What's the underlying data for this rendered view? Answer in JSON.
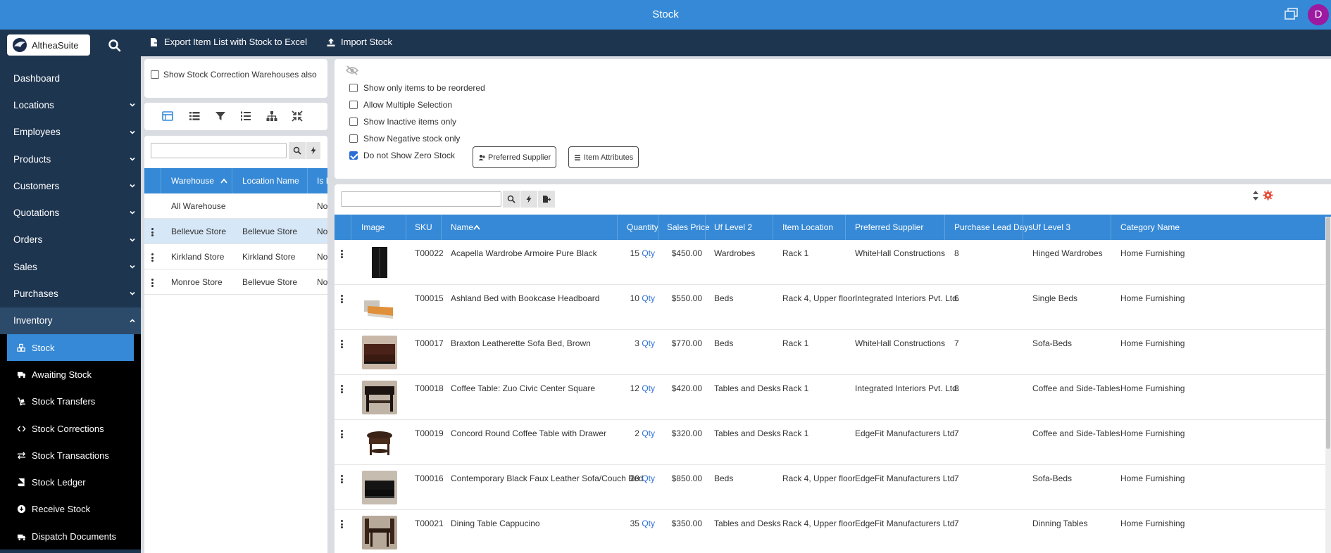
{
  "topbar": {
    "title": "Stock",
    "avatar_letter": "D"
  },
  "brand": {
    "name": "AltheaSuite"
  },
  "colors": {
    "primary": "#3689d6",
    "sidebar": "#1e3550",
    "accent": "#e8432d",
    "link": "#2a6fd6"
  },
  "sidebar": {
    "items": [
      {
        "label": "Dashboard",
        "icon": "none"
      },
      {
        "label": "Locations",
        "icon": "chevron-down-icon"
      },
      {
        "label": "Employees",
        "icon": "chevron-down-icon"
      },
      {
        "label": "Products",
        "icon": "chevron-down-icon"
      },
      {
        "label": "Customers",
        "icon": "chevron-down-icon"
      },
      {
        "label": "Quotations",
        "icon": "chevron-down-icon"
      },
      {
        "label": "Orders",
        "icon": "chevron-down-icon"
      },
      {
        "label": "Sales",
        "icon": "chevron-down-icon"
      },
      {
        "label": "Purchases",
        "icon": "chevron-down-icon"
      },
      {
        "label": "Inventory",
        "icon": "chevron-up-icon"
      }
    ],
    "sub_items": [
      {
        "label": "Stock",
        "icon": "cubes-icon"
      },
      {
        "label": "Awaiting Stock",
        "icon": "truck-icon"
      },
      {
        "label": "Stock Transfers",
        "icon": "dolly-icon"
      },
      {
        "label": "Stock Corrections",
        "icon": "code-icon"
      },
      {
        "label": "Stock Transactions",
        "icon": "exchange-icon"
      },
      {
        "label": "Stock Ledger",
        "icon": "book-icon"
      },
      {
        "label": "Receive Stock",
        "icon": "download-circle-icon"
      },
      {
        "label": "Dispatch Documents",
        "icon": "truck-loading-icon"
      }
    ]
  },
  "toolbar": {
    "export_label": "Export Item List with Stock to Excel",
    "import_label": "Import Stock"
  },
  "warehouse_options": {
    "show_correction_label": "Show Stock Correction Warehouses also"
  },
  "warehouse_grid": {
    "columns": [
      "Warehouse",
      "Location Name",
      "Is I"
    ],
    "rows": [
      {
        "warehouse": "All Warehouse",
        "location": "",
        "is": "No"
      },
      {
        "warehouse": "Bellevue Store",
        "location": "Bellevue Store",
        "is": "No"
      },
      {
        "warehouse": "Kirkland Store",
        "location": "Kirkland Store",
        "is": "No"
      },
      {
        "warehouse": "Monroe Store",
        "location": "Bellevue Store",
        "is": "No"
      }
    ]
  },
  "filters": {
    "reorder_label": "Show only items to be reordered",
    "multi_label": "Allow Multiple Selection",
    "inactive_label": "Show Inactive items only",
    "negative_label": "Show Negative stock only",
    "zero_label": "Do not Show Zero Stock",
    "preferred_supplier_btn": "Preferred Supplier",
    "item_attributes_btn": "Item Attributes"
  },
  "stock_grid": {
    "columns": {
      "image": "Image",
      "sku": "SKU",
      "name": "Name",
      "quantity": "Quantity",
      "price": "Sales Price",
      "uf2": "Uf Level 2",
      "location": "Item Location",
      "supplier": "Preferred Supplier",
      "lead": "Purchase Lead Days",
      "uf3": "Uf Level 3",
      "category": "Category Name"
    },
    "qty_unit": "Qty",
    "rows": [
      {
        "sku": "T00022",
        "name": "Acapella Wardrobe Armoire Pure Black",
        "qty": "15",
        "price": "$450.00",
        "uf2": "Wardrobes",
        "location": "Rack 1",
        "supplier": "WhiteHall Constructions",
        "lead": "8",
        "uf3": "Hinged Wardrobes",
        "category": "Home Furnishing"
      },
      {
        "sku": "T00015",
        "name": "Ashland Bed with Bookcase Headboard",
        "qty": "10",
        "price": "$550.00",
        "uf2": "Beds",
        "location": "Rack 4, Upper floor",
        "supplier": "Integrated Interiors Pvt. Ltd.",
        "lead": "6",
        "uf3": "Single Beds",
        "category": "Home Furnishing"
      },
      {
        "sku": "T00017",
        "name": "Braxton Leatherette Sofa Bed, Brown",
        "qty": "3",
        "price": "$770.00",
        "uf2": "Beds",
        "location": "Rack 1",
        "supplier": "WhiteHall Constructions",
        "lead": "7",
        "uf3": "Sofa-Beds",
        "category": "Home Furnishing"
      },
      {
        "sku": "T00018",
        "name": "Coffee Table: Zuo Civic Center Square",
        "qty": "12",
        "price": "$420.00",
        "uf2": "Tables and Desks",
        "location": "Rack 1",
        "supplier": "Integrated Interiors Pvt. Ltd.",
        "lead": "8",
        "uf3": "Coffee and Side-Tables",
        "category": "Home Furnishing"
      },
      {
        "sku": "T00019",
        "name": "Concord Round Coffee Table with Drawer",
        "qty": "2",
        "price": "$320.00",
        "uf2": "Tables and Desks",
        "location": "Rack 1",
        "supplier": "EdgeFit Manufacturers Ltd.",
        "lead": "7",
        "uf3": "Coffee and Side-Tables",
        "category": "Home Furnishing"
      },
      {
        "sku": "T00016",
        "name": "Contemporary Black Faux Leather Sofa/Couch Bed",
        "qty": "20",
        "price": "$850.00",
        "uf2": "Beds",
        "location": "Rack 4, Upper floor",
        "supplier": "EdgeFit Manufacturers Ltd.",
        "lead": "7",
        "uf3": "Sofa-Beds",
        "category": "Home Furnishing"
      },
      {
        "sku": "T00021",
        "name": "Dining Table Cappucino",
        "qty": "35",
        "price": "$350.00",
        "uf2": "Tables and Desks",
        "location": "Rack 4, Upper floor",
        "supplier": "EdgeFit Manufacturers Ltd.",
        "lead": "7",
        "uf3": "Dinning Tables",
        "category": "Home Furnishing"
      }
    ]
  }
}
